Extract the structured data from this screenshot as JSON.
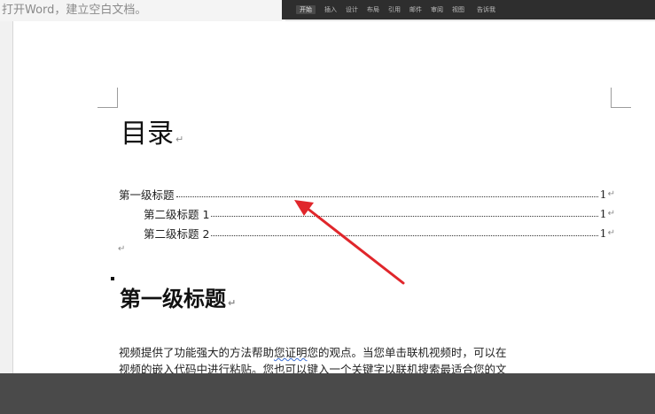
{
  "caption": {
    "text": "打开Word，建立空白文档。"
  },
  "ribbon": {
    "tabs": [
      {
        "label": "开始",
        "active": true
      },
      {
        "label": "插入",
        "active": false
      },
      {
        "label": "设计",
        "active": false
      },
      {
        "label": "布局",
        "active": false
      },
      {
        "label": "引用",
        "active": false
      },
      {
        "label": "邮件",
        "active": false
      },
      {
        "label": "审阅",
        "active": false
      },
      {
        "label": "视图",
        "active": false
      },
      {
        "label": "告诉我",
        "active": false
      }
    ]
  },
  "document": {
    "toc_title": "目录",
    "paragraph_mark": "↵",
    "toc_entries": [
      {
        "label": "第一级标题",
        "page": "1"
      },
      {
        "label": "第二级标题 1",
        "page": "1"
      },
      {
        "label": "第二级标题 2",
        "page": "1"
      }
    ],
    "heading_1": "第一级标题",
    "body_line_1": {
      "before": "视频提供了功能强大的方法帮助",
      "flagged": "您证明",
      "after": "您的观点。当您单击联机视频时，可以在"
    },
    "body_line_2": "视频的嵌入代码中进行粘贴。您也可以键入一个关键字以联机搜索最适合您的文"
  },
  "annotation": {
    "arrow_color": "#e0262b"
  },
  "colors": {
    "ribbon_bg": "#2e2e2e",
    "status_bar_bg": "#4a4a4a",
    "page_bg": "#ffffff"
  }
}
